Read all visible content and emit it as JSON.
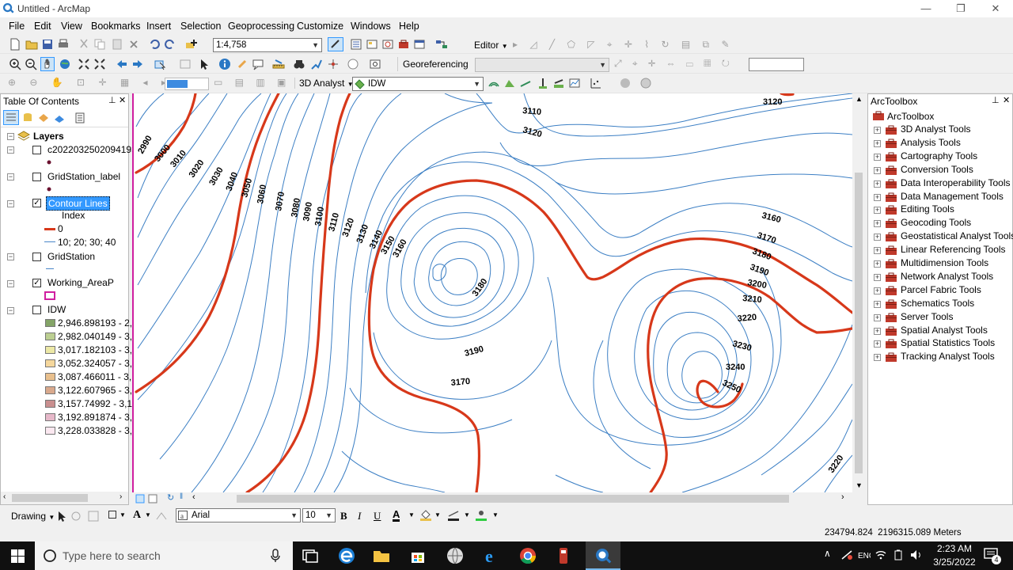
{
  "window": {
    "title": "Untitled - ArcMap",
    "minimize": "—",
    "restore": "❐",
    "close": "✕"
  },
  "menu": [
    "File",
    "Edit",
    "View",
    "Bookmarks",
    "Insert",
    "Selection",
    "Geoprocessing",
    "Customize",
    "Windows",
    "Help"
  ],
  "toolbar": {
    "scale": "1:4,758",
    "editor": "Editor",
    "georeferencing": "Georeferencing",
    "analyst3d": "3D Analyst",
    "idw_layer": "IDW"
  },
  "toc": {
    "title": "Table Of Contents",
    "pin": "⊥",
    "close": "✕",
    "root": "Layers",
    "layers": [
      {
        "name": "c20220325020941931",
        "checked": false
      },
      {
        "name": "GridStation_label",
        "checked": false
      },
      {
        "name": "Contour Lines",
        "checked": true,
        "selected": true,
        "sub": "Index",
        "entries": [
          {
            "label": "0",
            "color": "#d7381a"
          },
          {
            "label": "10; 20; 30; 40",
            "color": "#4a86c8"
          }
        ]
      },
      {
        "name": "GridStation",
        "checked": false
      },
      {
        "name": "Working_AreaP",
        "checked": true
      },
      {
        "name": "IDW",
        "checked": false,
        "classes": [
          {
            "label": "2,946.898193 - 2,9",
            "color": "#84a467"
          },
          {
            "label": "2,982.040149 - 3,0",
            "color": "#bccf92"
          },
          {
            "label": "3,017.182103 - 3,0",
            "color": "#ece8a6"
          },
          {
            "label": "3,052.324057 - 3,0",
            "color": "#f5d79c"
          },
          {
            "label": "3,087.466011 - 3,1",
            "color": "#e9c08e"
          },
          {
            "label": "3,122.607965 - 3,1",
            "color": "#d9a98d"
          },
          {
            "label": "3,157.74992 - 3,19",
            "color": "#c98f8f"
          },
          {
            "label": "3,192.891874 - 3,2",
            "color": "#e6b8c9"
          },
          {
            "label": "3,228.033828 - 3,2",
            "color": "#fbe8f0"
          }
        ]
      }
    ]
  },
  "map": {
    "contour_labels": [
      "2990",
      "3000",
      "3010",
      "3020",
      "3030",
      "3040",
      "3050",
      "3060",
      "3070",
      "3080",
      "3090",
      "3100",
      "3110",
      "3120",
      "3130",
      "3140",
      "3150",
      "3160",
      "3110",
      "3120",
      "3120",
      "3160",
      "3170",
      "3180",
      "3190",
      "3200",
      "3210",
      "3220",
      "3230",
      "3240",
      "3250",
      "3180",
      "3190",
      "3170",
      "3220"
    ]
  },
  "arctoolbox": {
    "title": "ArcToolbox",
    "root": "ArcToolbox",
    "tools": [
      "3D Analyst Tools",
      "Analysis Tools",
      "Cartography Tools",
      "Conversion Tools",
      "Data Interoperability Tools",
      "Data Management Tools",
      "Editing Tools",
      "Geocoding Tools",
      "Geostatistical Analyst Tools",
      "Linear Referencing Tools",
      "Multidimension Tools",
      "Network Analyst Tools",
      "Parcel Fabric Tools",
      "Schematics Tools",
      "Server Tools",
      "Spatial Analyst Tools",
      "Spatial Statistics Tools",
      "Tracking Analyst Tools"
    ]
  },
  "drawing": {
    "label": "Drawing",
    "font": "Arial",
    "size": "10",
    "bold": "B",
    "italic": "I",
    "underline": "U",
    "font_color_label": "A"
  },
  "status": {
    "coords": "234794.824  2196315.089 Meters"
  },
  "taskbar": {
    "search_placeholder": "Type here to search",
    "time": "2:23 AM",
    "date": "3/25/2022",
    "notifications": "4"
  },
  "colors": {
    "index_contour": "#d7381a",
    "contour": "#3c7fc4",
    "selection": "#3399ff"
  }
}
